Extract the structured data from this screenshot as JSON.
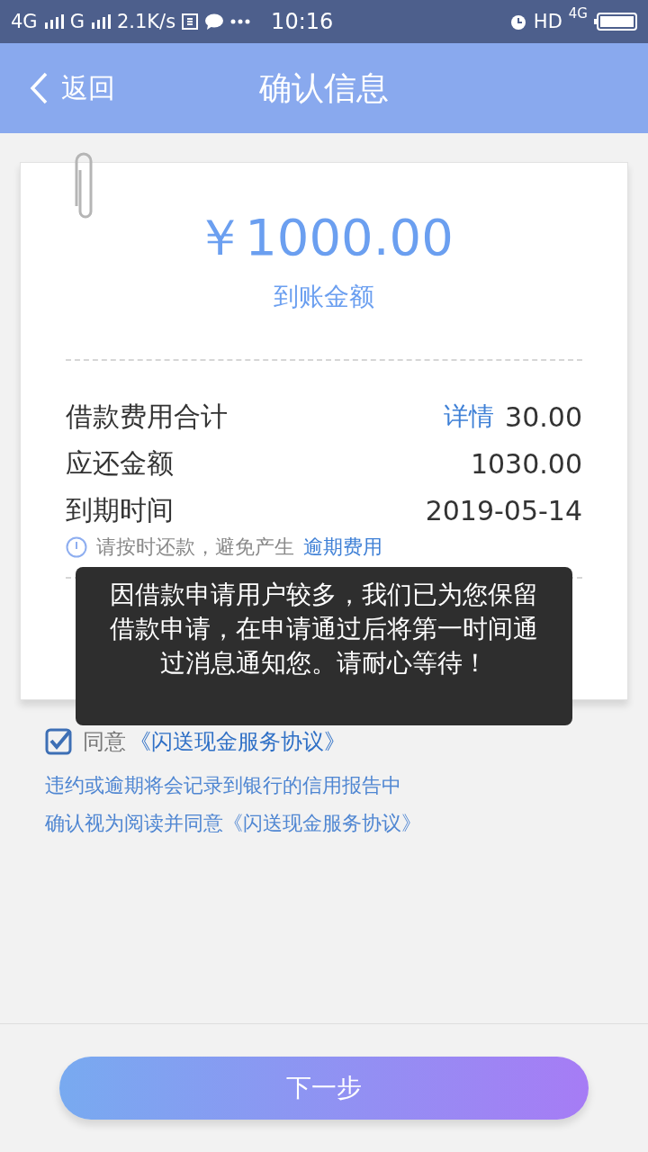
{
  "status_bar": {
    "network_1": "4G",
    "network_2": "G",
    "speed": "2.1K/s",
    "time": "10:16",
    "hd": "HD",
    "network_3": "4G"
  },
  "header": {
    "back": "返回",
    "title": "确认信息"
  },
  "receipt": {
    "amount": "￥1000.00",
    "amount_label": "到账金额",
    "rows": [
      {
        "label": "借款费用合计",
        "link": "详情",
        "value": "30.00"
      },
      {
        "label": "应还金额",
        "value": "1030.00"
      },
      {
        "label": "到期时间",
        "value": "2019-05-14"
      }
    ],
    "tip": "请按时还款，避免产生",
    "tip_link": "逾期费用"
  },
  "agreement": {
    "checked": true,
    "text": "同意",
    "link": "《闪送现金服务协议》"
  },
  "notes": [
    "违约或逾期将会记录到银行的信用报告中",
    "确认视为阅读并同意《闪送现金服务协议》"
  ],
  "toast": "因借款申请用户较多，我们已为您保留借款申请，在申请通过后将第一时间通过消息通知您。请耐心等待！",
  "next_button": "下一步"
}
